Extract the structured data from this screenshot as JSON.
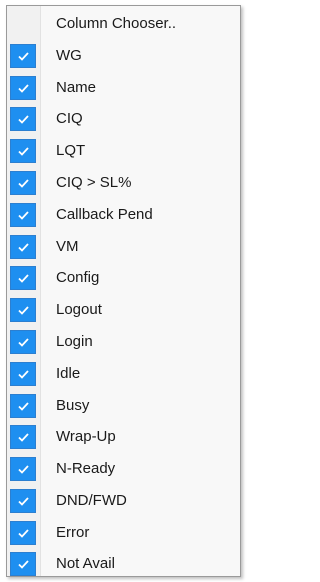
{
  "menu": {
    "header_label": "Column Chooser..",
    "accent_color": "#1e8ff0",
    "check_icon": "checkmark-icon",
    "items": [
      {
        "label": "WG",
        "checked": true
      },
      {
        "label": "Name",
        "checked": true
      },
      {
        "label": "CIQ",
        "checked": true
      },
      {
        "label": "LQT",
        "checked": true
      },
      {
        "label": "CIQ > SL%",
        "checked": true
      },
      {
        "label": "Callback Pend",
        "checked": true
      },
      {
        "label": "VM",
        "checked": true
      },
      {
        "label": "Config",
        "checked": true
      },
      {
        "label": "Logout",
        "checked": true
      },
      {
        "label": "Login",
        "checked": true
      },
      {
        "label": "Idle",
        "checked": true
      },
      {
        "label": "Busy",
        "checked": true
      },
      {
        "label": "Wrap-Up",
        "checked": true
      },
      {
        "label": "N-Ready",
        "checked": true
      },
      {
        "label": "DND/FWD",
        "checked": true
      },
      {
        "label": "Error",
        "checked": true
      },
      {
        "label": "Not Avail",
        "checked": true
      }
    ]
  }
}
